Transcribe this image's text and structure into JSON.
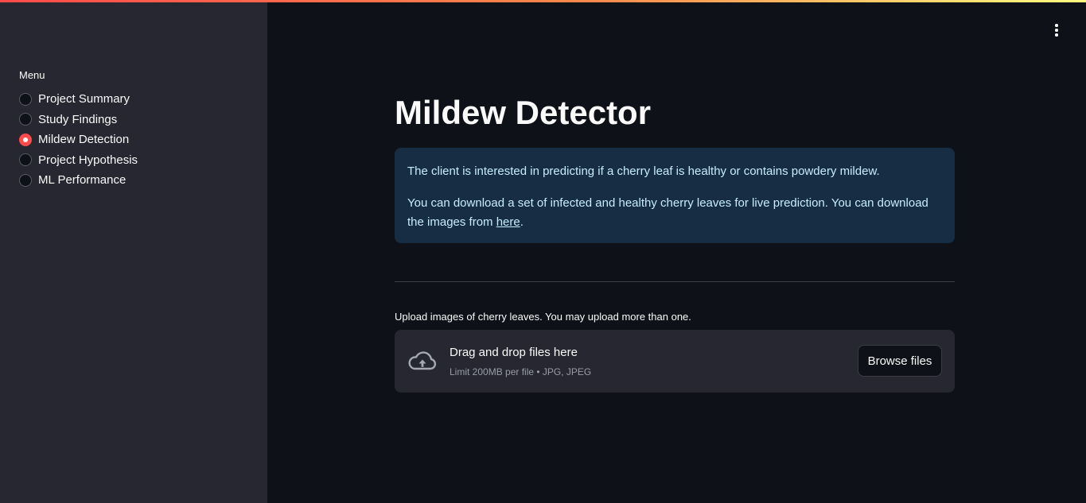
{
  "sidebar": {
    "menu_label": "Menu",
    "items": [
      {
        "label": "Project Summary",
        "selected": false
      },
      {
        "label": "Study Findings",
        "selected": false
      },
      {
        "label": "Mildew Detection",
        "selected": true
      },
      {
        "label": "Project Hypothesis",
        "selected": false
      },
      {
        "label": "ML Performance",
        "selected": false
      }
    ]
  },
  "header": {
    "menu_icon": "kebab-menu-icon"
  },
  "main": {
    "title": "Mildew Detector",
    "info": {
      "line1": "The client is interested in predicting if a cherry leaf is healthy or contains powdery mildew.",
      "line2_prefix": "You can download a set of infected and healthy cherry leaves for live prediction. You can download the images from ",
      "link_text": "here",
      "line2_suffix": "."
    },
    "uploader": {
      "label": "Upload images of cherry leaves. You may upload more than one.",
      "drop_title": "Drag and drop files here",
      "drop_subtitle": "Limit 200MB per file • JPG, JPEG",
      "browse_label": "Browse files",
      "icon": "cloud-upload-icon"
    }
  },
  "colors": {
    "accent": "#ff4b4b",
    "background": "#0e1117",
    "sidebar_bg": "#262730",
    "info_bg": "#172d43",
    "info_text": "#c7ebff"
  }
}
